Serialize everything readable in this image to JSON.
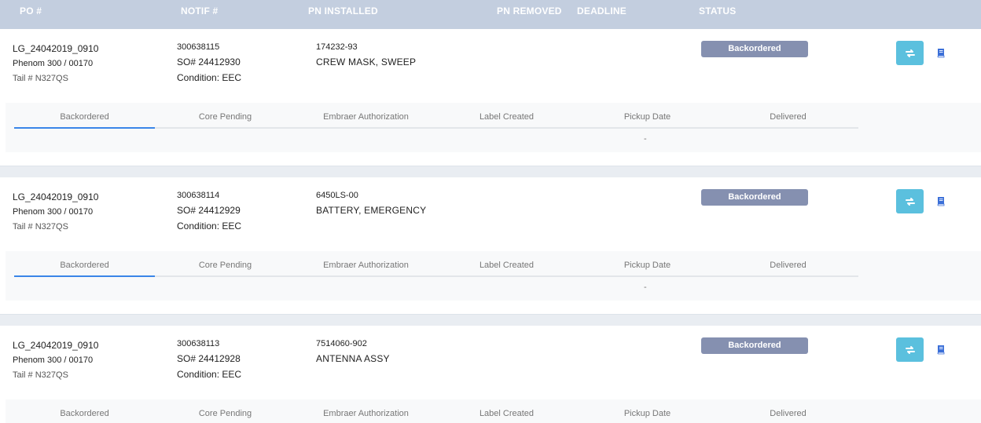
{
  "header": {
    "po": "PO #",
    "notif": "NOTIF #",
    "pn_installed": "PN INSTALLED",
    "pn_removed": "PN REMOVED",
    "deadline": "DEADLINE",
    "status": "STATUS"
  },
  "orders": [
    {
      "po": "LG_24042019_0910",
      "aircraft": "Phenom 300 / 00170",
      "tail": "Tail # N327QS",
      "notif": "300638115",
      "so": "SO# 24412930",
      "condition": "Condition: EEC",
      "pn": "174232-93",
      "description": "CREW MASK, SWEEP",
      "status": "Backordered",
      "steps": [
        "Backordered",
        "Core Pending",
        "Embraer Authorization",
        "Label Created",
        "Pickup Date",
        "Delivered"
      ],
      "pickup_value": "-"
    },
    {
      "po": "LG_24042019_0910",
      "aircraft": "Phenom 300 / 00170",
      "tail": "Tail # N327QS",
      "notif": "300638114",
      "so": "SO# 24412929",
      "condition": "Condition: EEC",
      "pn": "6450LS-00",
      "description": "BATTERY, EMERGENCY",
      "status": "Backordered",
      "steps": [
        "Backordered",
        "Core Pending",
        "Embraer Authorization",
        "Label Created",
        "Pickup Date",
        "Delivered"
      ],
      "pickup_value": "-"
    },
    {
      "po": "LG_24042019_0910",
      "aircraft": "Phenom 300 / 00170",
      "tail": "Tail # N327QS",
      "notif": "300638113",
      "so": "SO# 24412928",
      "condition": "Condition: EEC",
      "pn": "7514060-902",
      "description": "ANTENNA ASSY",
      "status": "Backordered",
      "steps": [
        "Backordered",
        "Core Pending",
        "Embraer Authorization",
        "Label Created",
        "Pickup Date",
        "Delivered"
      ],
      "pickup_value": "-"
    }
  ],
  "colors": {
    "header_bg": "#c3cedf",
    "badge_bg": "#8590b0",
    "action_btn": "#5bc0de",
    "active_step": "#3a86e8"
  },
  "icons": {
    "action": "exchange-icon",
    "details": "book-icon"
  }
}
